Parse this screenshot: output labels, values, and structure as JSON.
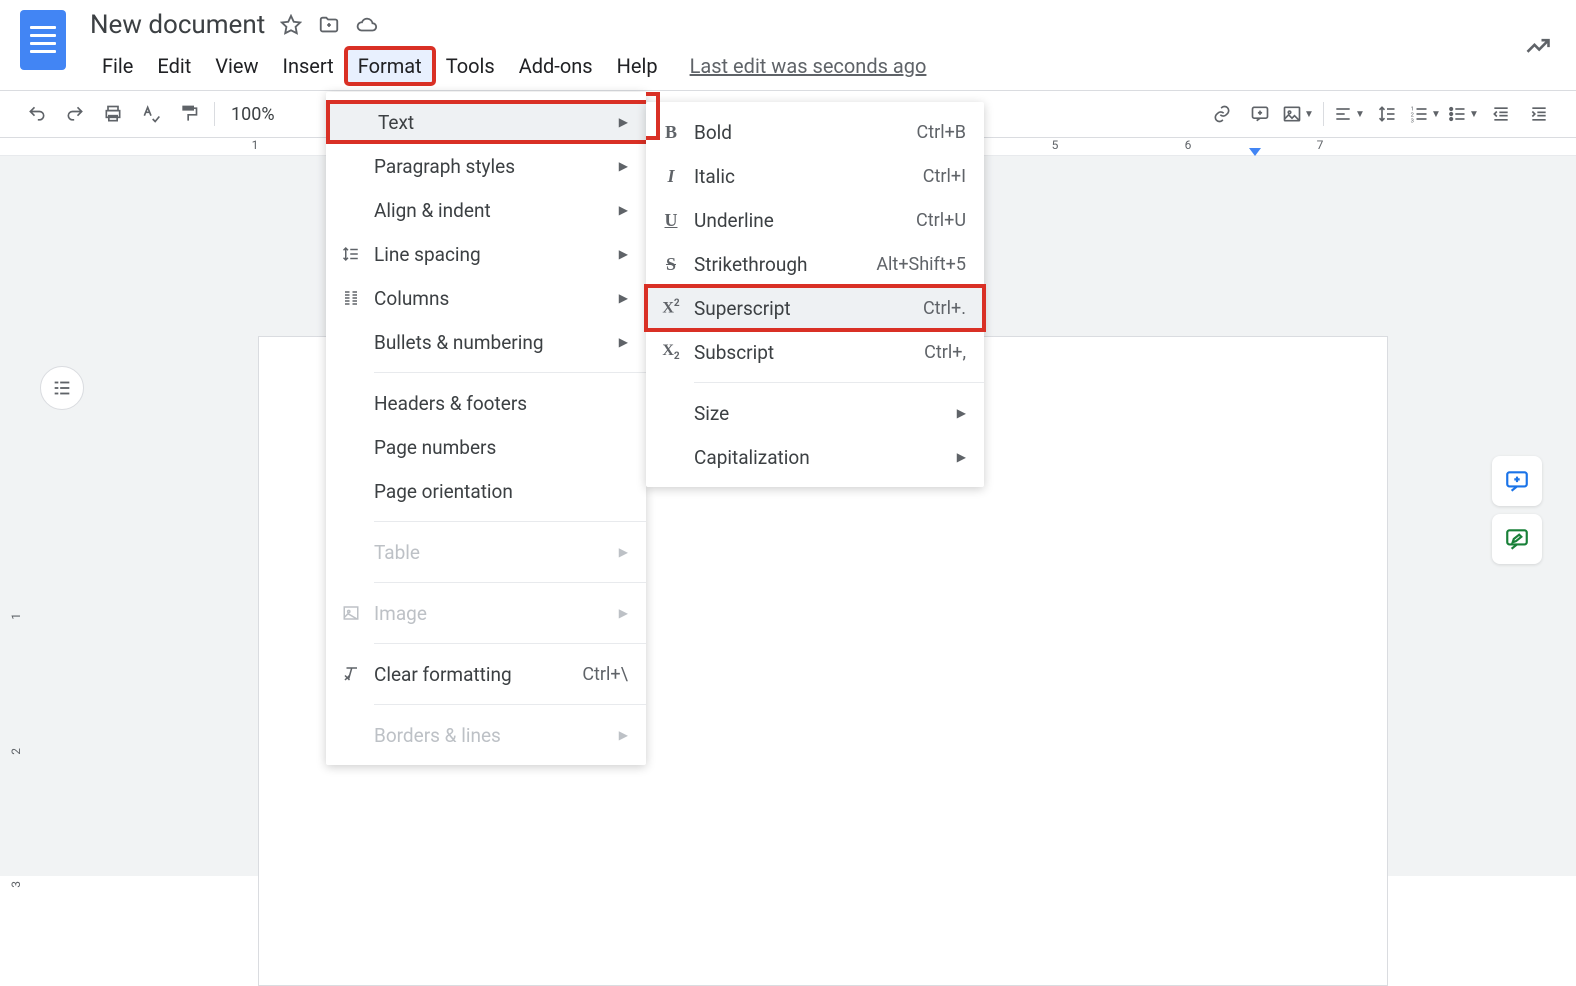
{
  "doc": {
    "title": "New document",
    "last_edit": "Last edit was seconds ago"
  },
  "menubar": {
    "file": "File",
    "edit": "Edit",
    "view": "View",
    "insert": "Insert",
    "format": "Format",
    "tools": "Tools",
    "addons": "Add-ons",
    "help": "Help"
  },
  "toolbar": {
    "zoom": "100%"
  },
  "ruler": {
    "n1": "1",
    "n5": "5",
    "n6": "6",
    "n7": "7"
  },
  "gutter": {
    "g1": "1",
    "g2": "2",
    "g3": "3"
  },
  "format_menu": {
    "text": "Text",
    "paragraph": "Paragraph styles",
    "align": "Align & indent",
    "line_spacing": "Line spacing",
    "columns": "Columns",
    "bullets": "Bullets & numbering",
    "headers": "Headers & footers",
    "page_numbers": "Page numbers",
    "page_orientation": "Page orientation",
    "table": "Table",
    "image": "Image",
    "clear": "Clear formatting",
    "clear_shortcut": "Ctrl+\\",
    "borders": "Borders & lines"
  },
  "text_submenu": {
    "bold": "Bold",
    "bold_sc": "Ctrl+B",
    "italic": "Italic",
    "italic_sc": "Ctrl+I",
    "underline": "Underline",
    "underline_sc": "Ctrl+U",
    "strike": "Strikethrough",
    "strike_sc": "Alt+Shift+5",
    "superscript": "Superscript",
    "superscript_sc": "Ctrl+.",
    "subscript": "Subscript",
    "subscript_sc": "Ctrl+,",
    "size": "Size",
    "capitalization": "Capitalization"
  }
}
